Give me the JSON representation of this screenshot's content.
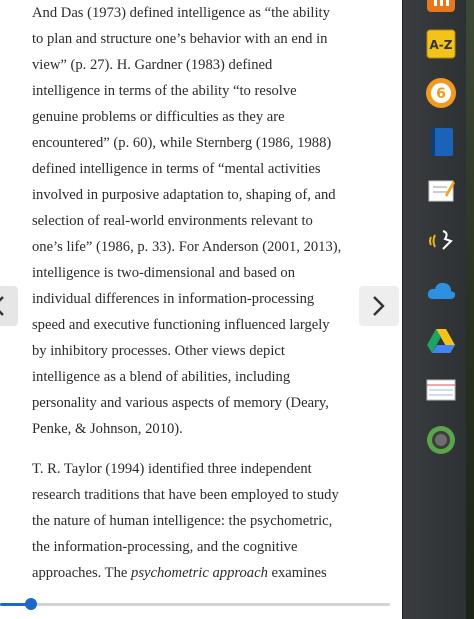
{
  "reader": {
    "paragraphs": [
      [
        "And Das (1973) defined intelligence as “the ability",
        "to plan and structure one’s behavior with an end in",
        "view” (p. 27). H. Gardner (1983) defined",
        "intelligence in terms of the ability “to resolve",
        "genuine problems or difficulties as they are",
        "encountered” (p. 60), while Sternberg (1986, 1988)",
        "defined intelligence in terms of “mental activities",
        "involved in purposive adaptation to, shaping of, and",
        "selection of real-world environments relevant to",
        "one’s life” (1986, p. 33). For Anderson (2001, 2013),",
        "intelligence is two-dimensional and based on",
        "individual differences in information-processing",
        "speed and executive functioning influenced largely",
        "by inhibitory processes. Other views depict",
        "intelligence as a blend of abilities, including",
        "personality and various aspects of memory (Deary,",
        "Penke, & Johnson, 2010)."
      ],
      [
        "T. R. Taylor (1994) identified three independent",
        "research traditions that have been employed to study",
        "the nature of human intelligence: the psychometric,",
        "the information-processing, and the cognitive",
        "approaches. The psychometric approach examines"
      ]
    ],
    "italic_phrase": "psychometric approach",
    "nav": {
      "prev_glyph": "‹",
      "next_glyph": "›"
    },
    "progress_fraction": 0.08,
    "accent_color": "#1f67c8"
  },
  "dock": {
    "items": [
      {
        "name": "app-partial-icon",
        "label": ""
      },
      {
        "name": "dictionary-icon",
        "label": "A-Z"
      },
      {
        "name": "audio-6-icon",
        "label": "6"
      },
      {
        "name": "notebook-icon",
        "label": ""
      },
      {
        "name": "notepad-icon",
        "label": ""
      },
      {
        "name": "speech-icon",
        "label": ""
      },
      {
        "name": "cloud-icon",
        "label": ""
      },
      {
        "name": "drive-icon",
        "label": ""
      },
      {
        "name": "index-cards-icon",
        "label": ""
      },
      {
        "name": "globe-icon",
        "label": ""
      }
    ]
  }
}
